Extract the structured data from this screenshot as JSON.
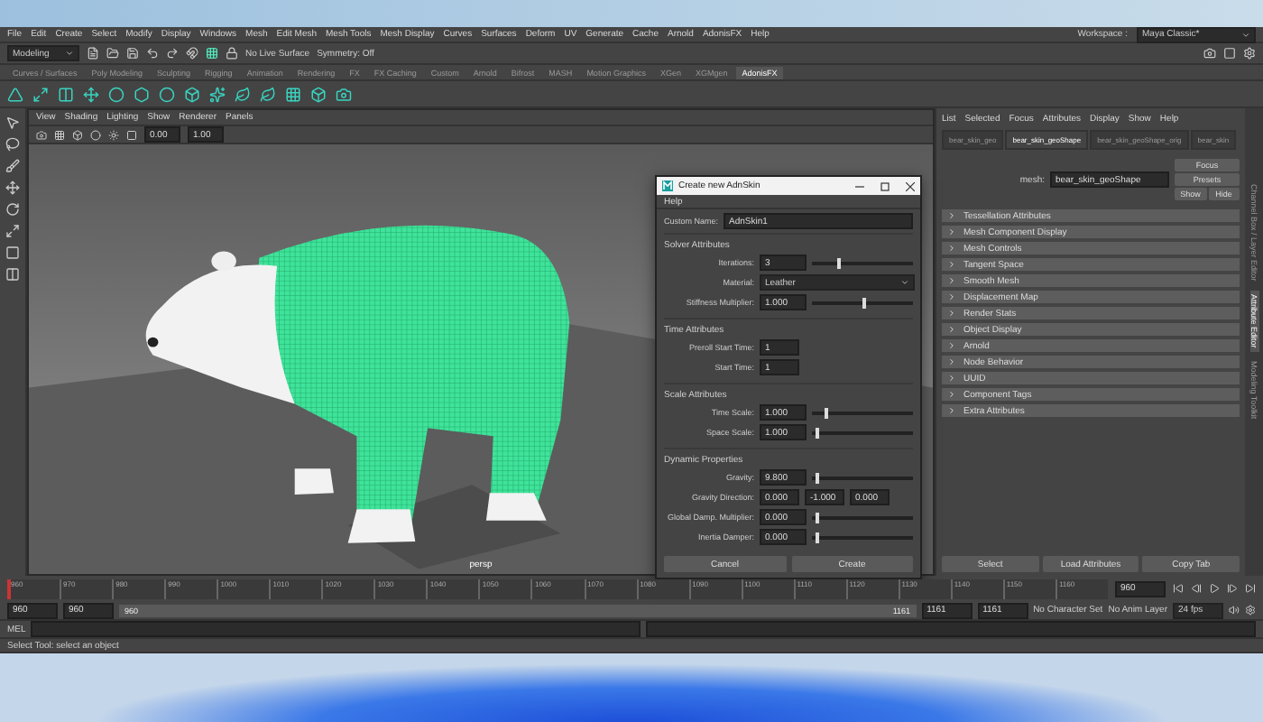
{
  "menu_bar": [
    "File",
    "Edit",
    "Create",
    "Select",
    "Modify",
    "Display",
    "Windows",
    "Mesh",
    "Edit Mesh",
    "Mesh Tools",
    "Mesh Display",
    "Curves",
    "Surfaces",
    "Deform",
    "UV",
    "Generate",
    "Cache",
    "Arnold",
    "AdonisFX",
    "Help"
  ],
  "status_line": {
    "mode": "Modeling",
    "live_surface": "No Live Surface",
    "symmetry": "Symmetry: Off",
    "workspace_label": "Workspace :",
    "workspace": "Maya Classic*"
  },
  "shelf_tabs": [
    {
      "label": "Curves / Surfaces",
      "selected": false
    },
    {
      "label": "Poly Modeling",
      "selected": false
    },
    {
      "label": "Sculpting",
      "selected": false
    },
    {
      "label": "Rigging",
      "selected": false
    },
    {
      "label": "Animation",
      "selected": false
    },
    {
      "label": "Rendering",
      "selected": false
    },
    {
      "label": "FX",
      "selected": false
    },
    {
      "label": "FX Caching",
      "selected": false
    },
    {
      "label": "Custom",
      "selected": false
    },
    {
      "label": "Arnold",
      "selected": false
    },
    {
      "label": "Bifrost",
      "selected": false
    },
    {
      "label": "MASH",
      "selected": false
    },
    {
      "label": "Motion Graphics",
      "selected": false
    },
    {
      "label": "XGen",
      "selected": false
    },
    {
      "label": "XGMgen",
      "selected": false
    },
    {
      "label": "AdonisFX",
      "selected": true
    }
  ],
  "viewport": {
    "menu": [
      "View",
      "Shading",
      "Lighting",
      "Show",
      "Renderer",
      "Panels"
    ],
    "exposure": "0.00",
    "gamma": "1.00",
    "camera": "persp"
  },
  "dialog": {
    "title": "Create new AdnSkin",
    "menu": [
      "Help"
    ],
    "name_label": "Custom Name:",
    "name_value": "AdnSkin1",
    "sections": [
      {
        "title": "Solver Attributes",
        "rows": [
          {
            "kind": "slider",
            "label": "Iterations:",
            "values": [
              "3"
            ],
            "level": 0.25
          },
          {
            "kind": "dropdown",
            "label": "Material:",
            "values": [
              "Leather"
            ]
          },
          {
            "kind": "slider",
            "label": "Stiffness Multiplier:",
            "values": [
              "1.000"
            ],
            "level": 0.5
          }
        ]
      },
      {
        "title": "Time Attributes",
        "rows": [
          {
            "kind": "field",
            "label": "Preroll Start Time:",
            "values": [
              "1"
            ]
          },
          {
            "kind": "field",
            "label": "Start Time:",
            "values": [
              "1"
            ]
          }
        ]
      },
      {
        "title": "Scale Attributes",
        "rows": [
          {
            "kind": "slider",
            "label": "Time Scale:",
            "values": [
              "1.000"
            ],
            "level": 0.12
          },
          {
            "kind": "slider",
            "label": "Space Scale:",
            "values": [
              "1.000"
            ],
            "level": 0.03
          }
        ]
      },
      {
        "title": "Dynamic Properties",
        "rows": [
          {
            "kind": "slider",
            "label": "Gravity:",
            "values": [
              "9.800"
            ],
            "level": 0.03
          },
          {
            "kind": "field",
            "label": "Gravity Direction:",
            "values": [
              "0.000",
              "-1.000",
              "0.000"
            ]
          },
          {
            "kind": "slider",
            "label": "Global Damp. Multiplier:",
            "values": [
              "0.000"
            ],
            "level": 0.03
          },
          {
            "kind": "slider",
            "label": "Inertia Damper:",
            "values": [
              "0.000"
            ],
            "level": 0.03
          }
        ]
      }
    ],
    "buttons": [
      "Cancel",
      "Create"
    ]
  },
  "attribute_editor": {
    "menu": [
      "List",
      "Selected",
      "Focus",
      "Attributes",
      "Display",
      "Show",
      "Help"
    ],
    "tabs": [
      {
        "label": "bear_skin_geo",
        "selected": false
      },
      {
        "label": "bear_skin_geoShape",
        "selected": true
      },
      {
        "label": "bear_skin_geoShape_orig",
        "selected": false
      },
      {
        "label": "bear_skin",
        "selected": false
      }
    ],
    "node_label": "mesh:",
    "node_value": "bear_skin_geoShape",
    "side_buttons": [
      "Focus",
      "Presets",
      "Show",
      "Hide"
    ],
    "sections": [
      "Tessellation Attributes",
      "Mesh Component Display",
      "Mesh Controls",
      "Tangent Space",
      "Smooth Mesh",
      "Displacement Map",
      "Render Stats",
      "Object Display",
      "Arnold",
      "Node Behavior",
      "UUID",
      "Component Tags",
      "Extra Attributes"
    ],
    "buttons": [
      "Select",
      "Load Attributes",
      "Copy Tab"
    ]
  },
  "side_tabs": [
    {
      "label": "Channel Box / Layer Editor",
      "selected": false
    },
    {
      "label": "Attribute Editor",
      "selected": true
    },
    {
      "label": "Modeling Toolkit",
      "selected": false
    }
  ],
  "timeline": {
    "ticks": [
      "960",
      "970",
      "980",
      "990",
      "1000",
      "1010",
      "1020",
      "1030",
      "1040",
      "1050",
      "1060",
      "1070",
      "1080",
      "1090",
      "1100",
      "1110",
      "1120",
      "1130",
      "1140",
      "1150",
      "1160"
    ],
    "current": "960",
    "level": 0
  },
  "range": {
    "start": "960",
    "playback_start": "960",
    "slider_start": "960",
    "slider_end": "1161",
    "level": 1,
    "playback_end": "1161",
    "end": "1161",
    "character_set": "No Character Set",
    "anim_layer": "No Anim Layer",
    "fps": "24 fps"
  },
  "command_line": {
    "language": "MEL"
  },
  "help_line": "Select Tool: select an object"
}
